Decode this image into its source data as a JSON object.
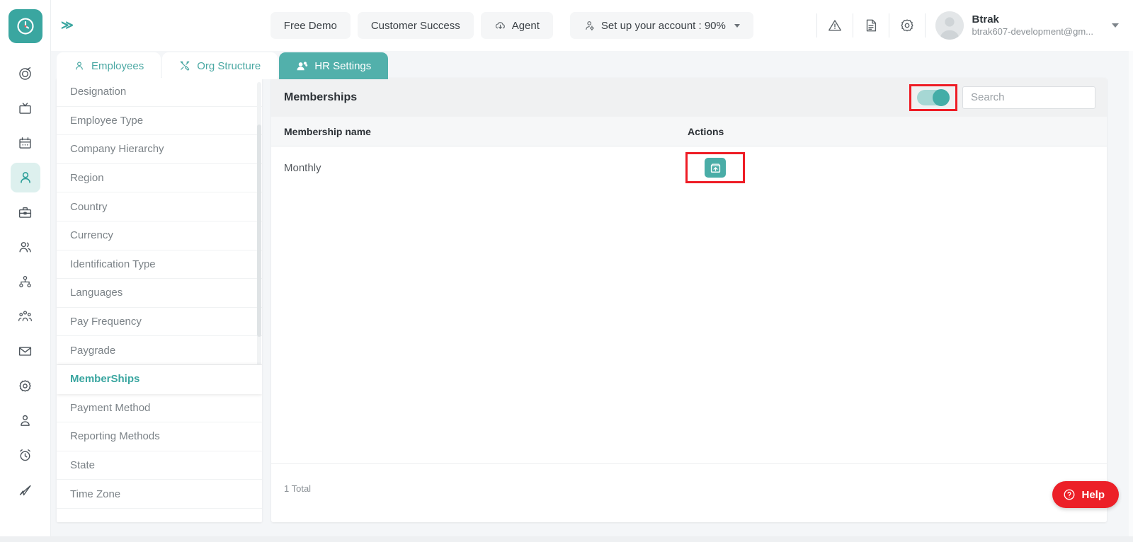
{
  "brand": {
    "accent": "#3aa6a0",
    "tab_active_bg": "#52b0ab",
    "highlight": "#ee1c25",
    "help_bg": "#ec2028"
  },
  "rail": {
    "logo_icon": "clock-logo-icon",
    "items": [
      {
        "icon": "target-icon",
        "name": "rail-item-dashboard",
        "active": false
      },
      {
        "icon": "tv-icon",
        "name": "rail-item-announcements",
        "active": false
      },
      {
        "icon": "calendar-icon",
        "name": "rail-item-calendar",
        "active": false
      },
      {
        "icon": "user-icon",
        "name": "rail-item-employees",
        "active": true
      },
      {
        "icon": "briefcase-icon",
        "name": "rail-item-jobs",
        "active": false
      },
      {
        "icon": "users-icon",
        "name": "rail-item-teams",
        "active": false
      },
      {
        "icon": "org-chart-icon",
        "name": "rail-item-org",
        "active": false
      },
      {
        "icon": "people-group-icon",
        "name": "rail-item-groups",
        "active": false
      },
      {
        "icon": "mail-icon",
        "name": "rail-item-mail",
        "active": false
      },
      {
        "icon": "gear-icon",
        "name": "rail-item-settings",
        "active": false
      },
      {
        "icon": "person-icon",
        "name": "rail-item-profile",
        "active": false
      },
      {
        "icon": "alarm-clock-icon",
        "name": "rail-item-attendance",
        "active": false
      },
      {
        "icon": "send-icon",
        "name": "rail-item-send",
        "active": false
      }
    ]
  },
  "topbar": {
    "expand_label": "≫",
    "free_demo": "Free Demo",
    "customer_success": "Customer Success",
    "agent": "Agent",
    "account_setup": "Set up your account : 90%",
    "icons": [
      "warning-icon",
      "document-icon",
      "gear-icon"
    ],
    "user": {
      "name": "Btrak",
      "email": "btrak607-development@gm..."
    }
  },
  "tabs": [
    {
      "label": "Employees",
      "icon": "user-icon",
      "active": false
    },
    {
      "label": "Org Structure",
      "icon": "tools-icon",
      "active": false
    },
    {
      "label": "HR Settings",
      "icon": "people-settings-icon",
      "active": true
    }
  ],
  "sidebar": {
    "items": [
      {
        "label": "Designation",
        "selected": false
      },
      {
        "label": "Employee Type",
        "selected": false
      },
      {
        "label": "Company Hierarchy",
        "selected": false
      },
      {
        "label": "Region",
        "selected": false
      },
      {
        "label": "Country",
        "selected": false
      },
      {
        "label": "Currency",
        "selected": false
      },
      {
        "label": "Identification Type",
        "selected": false
      },
      {
        "label": "Languages",
        "selected": false
      },
      {
        "label": "Pay Frequency",
        "selected": false
      },
      {
        "label": "Paygrade",
        "selected": false
      },
      {
        "label": "MemberShips",
        "selected": true
      },
      {
        "label": "Payment Method",
        "selected": false
      },
      {
        "label": "Reporting Methods",
        "selected": false
      },
      {
        "label": "State",
        "selected": false
      },
      {
        "label": "Time Zone",
        "selected": false
      }
    ]
  },
  "panel": {
    "title": "Memberships",
    "toggle": {
      "state": "on",
      "name": "archive-toggle"
    },
    "search": {
      "placeholder": "Search",
      "value": ""
    },
    "columns": {
      "name": "Membership name",
      "actions": "Actions"
    },
    "rows": [
      {
        "name": "Monthly",
        "action_icon": "restore-upload-icon"
      }
    ],
    "footer_total": "1 Total"
  },
  "help": {
    "label": "Help",
    "icon": "question-circle-icon"
  }
}
